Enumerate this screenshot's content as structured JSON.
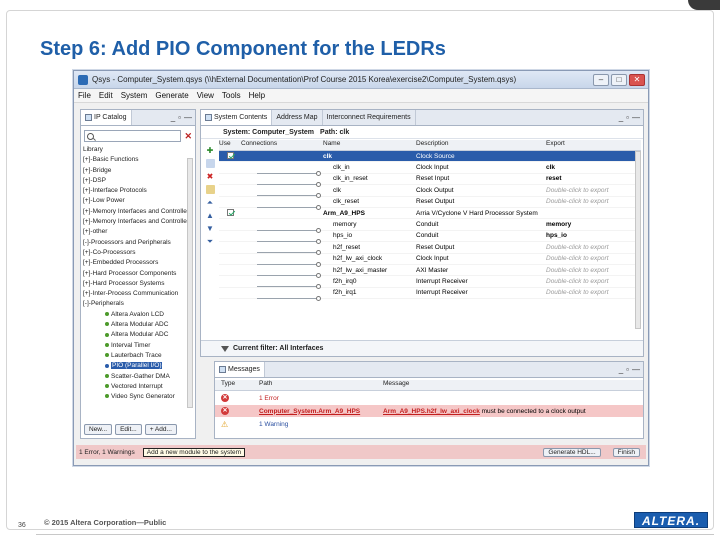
{
  "slide": {
    "title": "Step 6: Add PIO Component for the LEDRs",
    "page_number": "36",
    "copyright": "© 2015 Altera Corporation—Public",
    "logo": "ALTERA."
  },
  "window": {
    "title": "Qsys - Computer_System.qsys (\\\\hExternal Documentation\\Prof Course 2015 Korea\\exercise2\\Computer_System.qsys)",
    "buttons": [
      "–",
      "□",
      "✕"
    ]
  },
  "menu": [
    "File",
    "Edit",
    "System",
    "Generate",
    "View",
    "Tools",
    "Help"
  ],
  "ip_catalog": {
    "tab_label": "IP Catalog",
    "tree": [
      {
        "label": "Library",
        "selected": false
      },
      {
        "label": "[+]-Basic Functions",
        "selected": false
      },
      {
        "label": "[+]-Bridge",
        "selected": false
      },
      {
        "label": "[+]-DSP",
        "selected": false
      },
      {
        "label": "[+]-Interface Protocols",
        "selected": false
      },
      {
        "label": "[+]-Low Power",
        "selected": false
      },
      {
        "label": "[+]-Memory Interfaces and Controllers",
        "selected": false
      },
      {
        "label": "[+]-Memory Interfaces and Controllers",
        "selected": false
      },
      {
        "label": "[+]-other",
        "selected": false
      },
      {
        "label": "[-]-Processors and Peripherals",
        "selected": false
      },
      {
        "label": "  [+]-Co-Processors",
        "selected": false
      },
      {
        "label": "  [+]-Embedded Processors",
        "selected": false
      },
      {
        "label": "  [+]-Hard Processor Components",
        "selected": false
      },
      {
        "label": "  [+]-Hard Processor Systems",
        "selected": false
      },
      {
        "label": "  [+]-Inter-Process Communication",
        "selected": false
      },
      {
        "label": "  [-]-Peripherals",
        "selected": false
      },
      {
        "label": "Altera Avalon LCD",
        "selected": false,
        "bullet": true
      },
      {
        "label": "Altera Modular ADC",
        "selected": false,
        "bullet": true
      },
      {
        "label": "Altera Modular ADC",
        "selected": false,
        "bullet": true
      },
      {
        "label": "Interval Timer",
        "selected": false,
        "bullet": true
      },
      {
        "label": "Lauterbach Trace",
        "selected": false,
        "bullet": true
      },
      {
        "label": "PIO (Parallel I/O)",
        "selected": true,
        "bullet": true
      },
      {
        "label": "Scatter-Gather DMA",
        "selected": false,
        "bullet": true
      },
      {
        "label": "Vectored Interrupt",
        "selected": false,
        "bullet": true
      },
      {
        "label": "Video Sync Generator",
        "selected": false,
        "bullet": true
      }
    ],
    "buttons": [
      "New...",
      "Edit...",
      "+ Add..."
    ]
  },
  "system_contents": {
    "tabs": [
      "System Contents",
      "Address Map",
      "Interconnect Requirements"
    ],
    "breadcrumb_label": "System: Computer_System",
    "path_label": "Path: clk",
    "columns": [
      "Use",
      "Connections",
      "Name",
      "Description",
      "Export"
    ],
    "rows": [
      {
        "use": true,
        "name": "clk",
        "desc": "Clock Source",
        "export": "",
        "export_style": "",
        "selected": true,
        "hier": true
      },
      {
        "use": false,
        "name": "clk_in",
        "desc": "Clock Input",
        "export": "clk",
        "export_style": "bold",
        "selected": false,
        "hier": false
      },
      {
        "use": false,
        "name": "clk_in_reset",
        "desc": "Reset Input",
        "export": "reset",
        "export_style": "bold",
        "selected": false,
        "hier": false
      },
      {
        "use": false,
        "name": "clk",
        "desc": "Clock Output",
        "export": "Double-click to export",
        "export_style": "placeholder",
        "selected": false,
        "hier": false
      },
      {
        "use": false,
        "name": "clk_reset",
        "desc": "Reset Output",
        "export": "Double-click to export",
        "export_style": "placeholder",
        "selected": false,
        "hier": false
      },
      {
        "use": true,
        "name": "Arm_A9_HPS",
        "desc": "Arria V/Cyclone V Hard Processor System",
        "export": "",
        "export_style": "",
        "selected": false,
        "hier": true
      },
      {
        "use": false,
        "name": "memory",
        "desc": "Conduit",
        "export": "memory",
        "export_style": "bold",
        "selected": false,
        "hier": false
      },
      {
        "use": false,
        "name": "hps_io",
        "desc": "Conduit",
        "export": "hps_io",
        "export_style": "bold",
        "selected": false,
        "hier": false
      },
      {
        "use": false,
        "name": "h2f_reset",
        "desc": "Reset Output",
        "export": "Double-click to export",
        "export_style": "placeholder",
        "selected": false,
        "hier": false
      },
      {
        "use": false,
        "name": "h2f_lw_axi_clock",
        "desc": "Clock Input",
        "export": "Double-click to export",
        "export_style": "placeholder",
        "selected": false,
        "hier": false
      },
      {
        "use": false,
        "name": "h2f_lw_axi_master",
        "desc": "AXI Master",
        "export": "Double-click to export",
        "export_style": "placeholder",
        "selected": false,
        "hier": false
      },
      {
        "use": false,
        "name": "f2h_irq0",
        "desc": "Interrupt Receiver",
        "export": "Double-click to export",
        "export_style": "placeholder",
        "selected": false,
        "hier": false
      },
      {
        "use": false,
        "name": "f2h_irq1",
        "desc": "Interrupt Receiver",
        "export": "Double-click to export",
        "export_style": "placeholder",
        "selected": false,
        "hier": false
      }
    ],
    "filter_label": "Current filter: All Interfaces"
  },
  "messages": {
    "tab_label": "Messages",
    "columns": [
      "Type",
      "Path",
      "Message"
    ],
    "rows": [
      {
        "path": "1 Error",
        "message": "",
        "style": "error-summary"
      },
      {
        "path": "Computer_System.Arm_A9_HPS",
        "message": "Arm_A9_HPS.h2f_lw_axi_clock must be connected to a clock output",
        "style": "error-sel"
      },
      {
        "path": "1 Warning",
        "message": "",
        "style": "warning"
      }
    ]
  },
  "statusbar": {
    "summary": "1 Error, 1 Warnings",
    "tip": "Add a new module to the system",
    "generate_button": "Generate HDL...",
    "finish_button": "Finish"
  },
  "colors": {
    "title_blue": "#1f5fa8",
    "selection_blue": "#2a5caa",
    "error_red": "#c21f1f"
  }
}
